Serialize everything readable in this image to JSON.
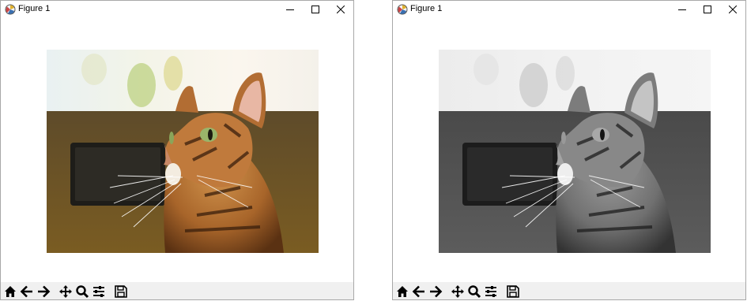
{
  "windows": [
    {
      "title": "Figure 1",
      "image": "color cat photo"
    },
    {
      "title": "Figure 1",
      "image": "grayscale cat photo"
    }
  ],
  "icons": {
    "app": "matplotlib-logo-icon",
    "minimize": "minimize-icon",
    "maximize": "maximize-icon",
    "close": "close-icon",
    "home": "home-icon",
    "back": "back-arrow-icon",
    "forward": "forward-arrow-icon",
    "pan": "pan-icon",
    "zoom": "zoom-icon",
    "configure": "configure-subplots-icon",
    "save": "save-icon"
  },
  "colors": {
    "toolbar_bg": "#f0f0f0",
    "window_border": "#a8a8a8"
  }
}
